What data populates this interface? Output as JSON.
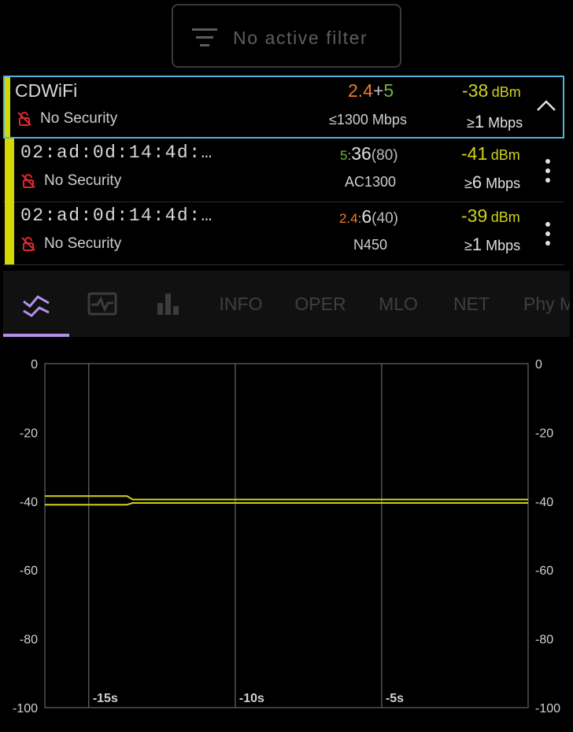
{
  "filter": {
    "label": "No active filter",
    "icon": "filter-icon"
  },
  "group": {
    "ssid": "CDWiFi",
    "security": "No Security",
    "band_a": "2.4",
    "band_plus": "+",
    "band_b": "5",
    "max_rate": "≤1300 Mbps",
    "signal": "-38",
    "signal_unit": "dBm",
    "min_rate_prefix": "≥",
    "min_rate_num": "1",
    "min_rate_unit": " Mbps",
    "collapse_icon": "chevron-up-icon"
  },
  "access_points": [
    {
      "bssid": "02:ad:0d:14:4d:…",
      "security": "No Security",
      "band": "5",
      "channel": "36",
      "width": "(80)",
      "standard": "AC1300",
      "signal": "-41",
      "signal_unit": "dBm",
      "rate_prefix": "≥",
      "rate_num": "6",
      "rate_unit": " Mbps"
    },
    {
      "bssid": "02:ad:0d:14:4d:…",
      "security": "No Security",
      "band": "2.4",
      "channel": "6",
      "width": "(40)",
      "standard": "N450",
      "signal": "-39",
      "signal_unit": "dBm",
      "rate_prefix": "≥",
      "rate_num": "1",
      "rate_unit": " Mbps"
    }
  ],
  "tabs": {
    "icons": [
      "signal-history-icon",
      "pulse-monitor-icon",
      "bar-chart-icon"
    ],
    "labels": [
      "INFO",
      "OPER",
      "MLO",
      "NET",
      "Phy M"
    ],
    "active": 0,
    "accent": "#b48ee9"
  },
  "chart_data": {
    "type": "line",
    "title": "",
    "xlabel": "",
    "ylabel": "",
    "x_ticks": [
      "-15s",
      "-10s",
      "-5s"
    ],
    "x_range_seconds": [
      -16.5,
      0
    ],
    "ylim": [
      -100,
      0
    ],
    "y_ticks": [
      "0",
      "-20",
      "-40",
      "-60",
      "-80",
      "-100"
    ],
    "y_tick_values": [
      0,
      -20,
      -40,
      -60,
      -80,
      -100
    ],
    "grid": true,
    "series_color": "#cfd31c",
    "series": [
      {
        "x": [
          -16.5,
          -13.7,
          -13.5,
          0
        ],
        "values": [
          -38.5,
          -38.5,
          -39.5,
          -39.5
        ]
      },
      {
        "x": [
          -16.5,
          -13.7,
          -13.5,
          0
        ],
        "values": [
          -41,
          -41,
          -40.5,
          -40.5
        ]
      }
    ]
  }
}
